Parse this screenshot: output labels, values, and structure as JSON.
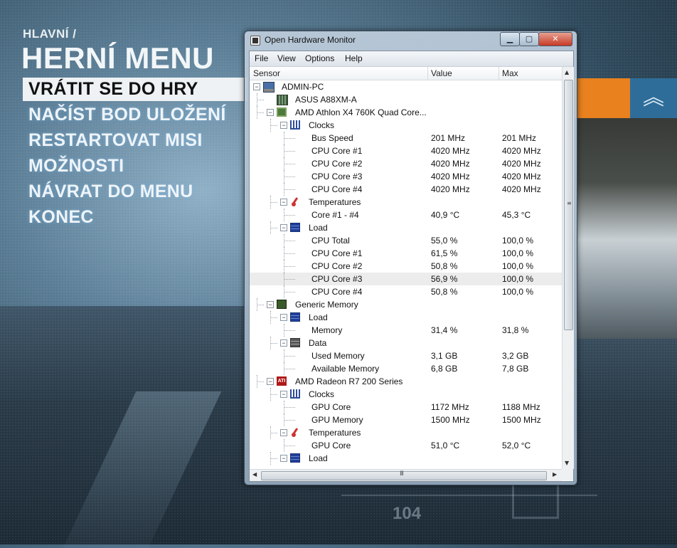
{
  "game": {
    "breadcrumb": "HLAVNÍ /",
    "title": "HERNÍ MENU",
    "items": [
      {
        "label": "VRÁTIT SE DO HRY",
        "active": true
      },
      {
        "label": "NAČÍST BOD ULOŽENÍ",
        "active": false
      },
      {
        "label": "RESTARTOVAT MISI",
        "active": false
      },
      {
        "label": "MOŽNOSTI",
        "active": false
      },
      {
        "label": "NÁVRAT DO MENU",
        "active": false
      },
      {
        "label": "KONEC",
        "active": false
      }
    ],
    "hud_number": "104",
    "rank_glyph": "︽",
    "accent_orange": "#e8811e",
    "accent_blue": "#2e6d9a"
  },
  "window": {
    "title": "Open Hardware Monitor",
    "min_glyph": "▁",
    "max_glyph": "▢",
    "close_glyph": "✕",
    "menu": [
      "File",
      "View",
      "Options",
      "Help"
    ],
    "columns": {
      "sensor": "Sensor",
      "value": "Value",
      "max": "Max"
    },
    "scroll_up": "▲",
    "scroll_down": "▼",
    "scroll_left": "◀",
    "scroll_right": "▶",
    "grip_v": "≡",
    "grip_h": "III"
  },
  "tree": [
    {
      "label": "ADMIN-PC",
      "value": "",
      "max": "",
      "level": 0,
      "icon": "computer-icon",
      "exp": "−"
    },
    {
      "label": "ASUS A88XM-A",
      "value": "",
      "max": "",
      "level": 1,
      "icon": "motherboard-icon",
      "exp": ""
    },
    {
      "label": "AMD Athlon X4 760K Quad Core...",
      "value": "",
      "max": "",
      "level": 1,
      "icon": "cpu-icon",
      "exp": "−"
    },
    {
      "label": "Clocks",
      "value": "",
      "max": "",
      "level": 2,
      "icon": "clock-icon",
      "exp": "−"
    },
    {
      "label": "Bus Speed",
      "value": "201 MHz",
      "max": "201 MHz",
      "level": 3,
      "icon": "",
      "exp": ""
    },
    {
      "label": "CPU Core #1",
      "value": "4020 MHz",
      "max": "4020 MHz",
      "level": 3,
      "icon": "",
      "exp": ""
    },
    {
      "label": "CPU Core #2",
      "value": "4020 MHz",
      "max": "4020 MHz",
      "level": 3,
      "icon": "",
      "exp": ""
    },
    {
      "label": "CPU Core #3",
      "value": "4020 MHz",
      "max": "4020 MHz",
      "level": 3,
      "icon": "",
      "exp": ""
    },
    {
      "label": "CPU Core #4",
      "value": "4020 MHz",
      "max": "4020 MHz",
      "level": 3,
      "icon": "",
      "exp": ""
    },
    {
      "label": "Temperatures",
      "value": "",
      "max": "",
      "level": 2,
      "icon": "thermometer-icon",
      "exp": "−"
    },
    {
      "label": "Core #1 - #4",
      "value": "40,9 °C",
      "max": "45,3 °C",
      "level": 3,
      "icon": "",
      "exp": ""
    },
    {
      "label": "Load",
      "value": "",
      "max": "",
      "level": 2,
      "icon": "load-icon",
      "exp": "−"
    },
    {
      "label": "CPU Total",
      "value": "55,0 %",
      "max": "100,0 %",
      "level": 3,
      "icon": "",
      "exp": ""
    },
    {
      "label": "CPU Core #1",
      "value": "61,5 %",
      "max": "100,0 %",
      "level": 3,
      "icon": "",
      "exp": ""
    },
    {
      "label": "CPU Core #2",
      "value": "50,8 %",
      "max": "100,0 %",
      "level": 3,
      "icon": "",
      "exp": ""
    },
    {
      "label": "CPU Core #3",
      "value": "56,9 %",
      "max": "100,0 %",
      "level": 3,
      "icon": "",
      "exp": "",
      "highlight": true
    },
    {
      "label": "CPU Core #4",
      "value": "50,8 %",
      "max": "100,0 %",
      "level": 3,
      "icon": "",
      "exp": ""
    },
    {
      "label": "Generic Memory",
      "value": "",
      "max": "",
      "level": 1,
      "icon": "memory-icon",
      "exp": "−"
    },
    {
      "label": "Load",
      "value": "",
      "max": "",
      "level": 2,
      "icon": "load-icon",
      "exp": "−"
    },
    {
      "label": "Memory",
      "value": "31,4 %",
      "max": "31,8 %",
      "level": 3,
      "icon": "",
      "exp": ""
    },
    {
      "label": "Data",
      "value": "",
      "max": "",
      "level": 2,
      "icon": "data-icon",
      "exp": "−"
    },
    {
      "label": "Used Memory",
      "value": "3,1 GB",
      "max": "3,2 GB",
      "level": 3,
      "icon": "",
      "exp": ""
    },
    {
      "label": "Available Memory",
      "value": "6,8 GB",
      "max": "7,8 GB",
      "level": 3,
      "icon": "",
      "exp": ""
    },
    {
      "label": "AMD Radeon R7 200 Series",
      "value": "",
      "max": "",
      "level": 1,
      "icon": "gpu-icon",
      "exp": "−"
    },
    {
      "label": "Clocks",
      "value": "",
      "max": "",
      "level": 2,
      "icon": "clock-icon",
      "exp": "−"
    },
    {
      "label": "GPU Core",
      "value": "1172 MHz",
      "max": "1188 MHz",
      "level": 3,
      "icon": "",
      "exp": ""
    },
    {
      "label": "GPU Memory",
      "value": "1500 MHz",
      "max": "1500 MHz",
      "level": 3,
      "icon": "",
      "exp": ""
    },
    {
      "label": "Temperatures",
      "value": "",
      "max": "",
      "level": 2,
      "icon": "thermometer-icon",
      "exp": "−"
    },
    {
      "label": "GPU Core",
      "value": "51,0 °C",
      "max": "52,0 °C",
      "level": 3,
      "icon": "",
      "exp": ""
    },
    {
      "label": "Load",
      "value": "",
      "max": "",
      "level": 2,
      "icon": "load-icon",
      "exp": "−"
    }
  ]
}
